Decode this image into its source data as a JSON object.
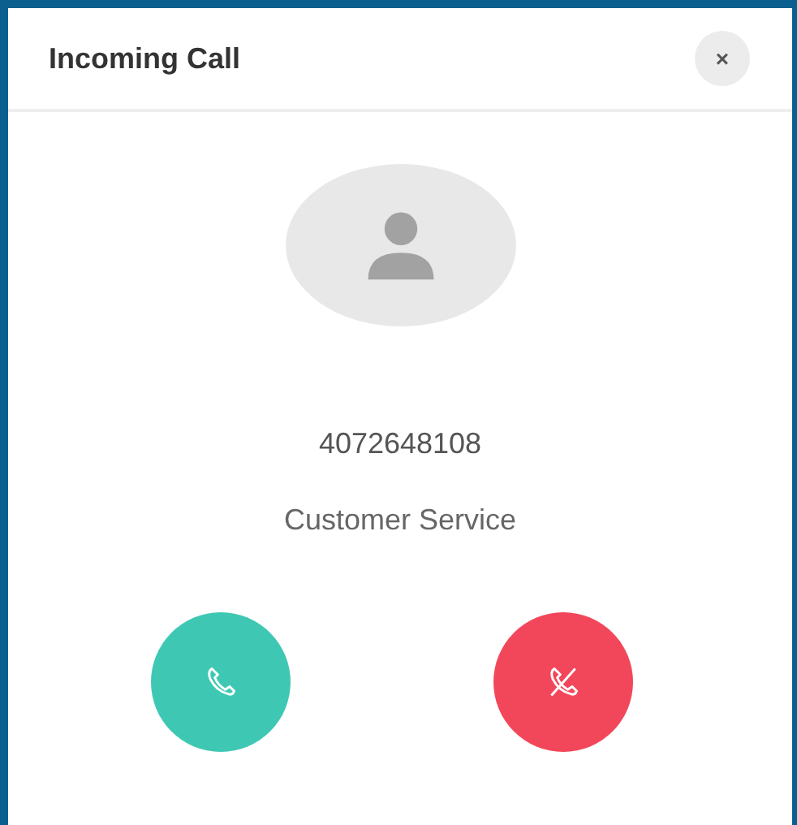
{
  "dialog": {
    "title": "Incoming Call",
    "close": "×"
  },
  "caller": {
    "number": "4072648108",
    "label": "Customer Service"
  },
  "actions": [
    {
      "kind": "accept",
      "color": "#3ec8b4"
    },
    {
      "kind": "decline",
      "color": "#f2475a"
    }
  ]
}
